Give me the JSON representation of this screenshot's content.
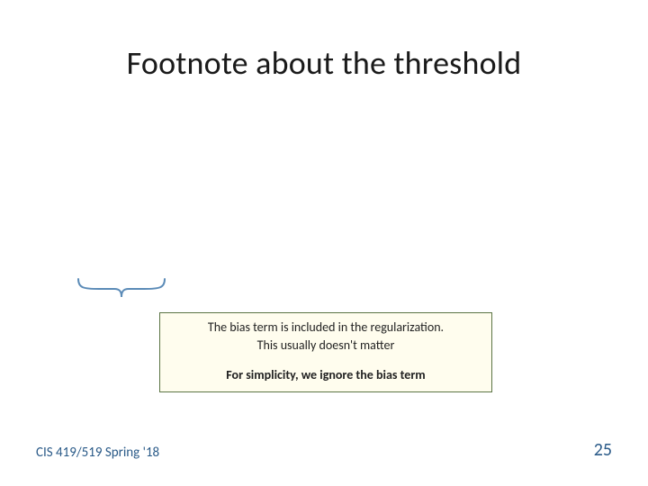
{
  "title": "Footnote about the threshold",
  "callout": {
    "line1": "The bias term is included in the regularization.",
    "line2": "This usually doesn't matter",
    "line3": "For simplicity, we ignore the bias term"
  },
  "footer": {
    "left": "CIS 419/519 Spring '18",
    "right": "25"
  }
}
